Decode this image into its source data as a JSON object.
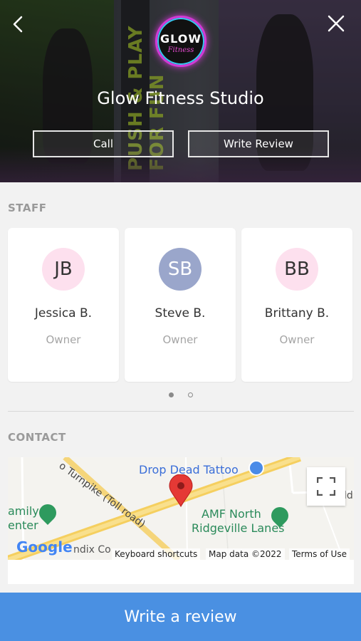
{
  "hero": {
    "studio_name": "Glow Fitness Studio",
    "logo_text": "GLOW",
    "logo_subtext": "Fitness",
    "wall_text": "PUSH & PLAY FOR FUN",
    "call_label": "Call",
    "write_review_label": "Write Review",
    "back_icon": "chevron-left-icon",
    "close_icon": "close-icon"
  },
  "staff": {
    "section_label": "STAFF",
    "members": [
      {
        "initials": "JB",
        "name": "Jessica B.",
        "role": "Owner",
        "color": "#fde0ee"
      },
      {
        "initials": "SB",
        "name": "Steve B.",
        "role": "Owner",
        "color": "#9aa6cb"
      },
      {
        "initials": "BB",
        "name": "Brittany B.",
        "role": "Owner",
        "color": "#fde0ee"
      }
    ],
    "page_indicator": {
      "current": 1,
      "total": 2
    }
  },
  "contact": {
    "section_label": "CONTACT",
    "map": {
      "labels": {
        "tattoo": "Drop Dead Tattoo",
        "turnpike": "o Turnpike (Toll road)",
        "amf_line1": "AMF North",
        "amf_line2": "Ridgeville Lanes",
        "family_line1": "amily",
        "family_line2": "enter",
        "partial_right": "ld",
        "partial_bottom": "ndix Co"
      },
      "google_logo": "Google",
      "attribution": {
        "shortcuts": "Keyboard shortcuts",
        "data": "Map data ©2022",
        "terms": "Terms of Use"
      },
      "fullscreen_icon": "fullscreen-icon"
    }
  },
  "footer": {
    "button_label": "Write a review",
    "color": "#4a90e2"
  }
}
